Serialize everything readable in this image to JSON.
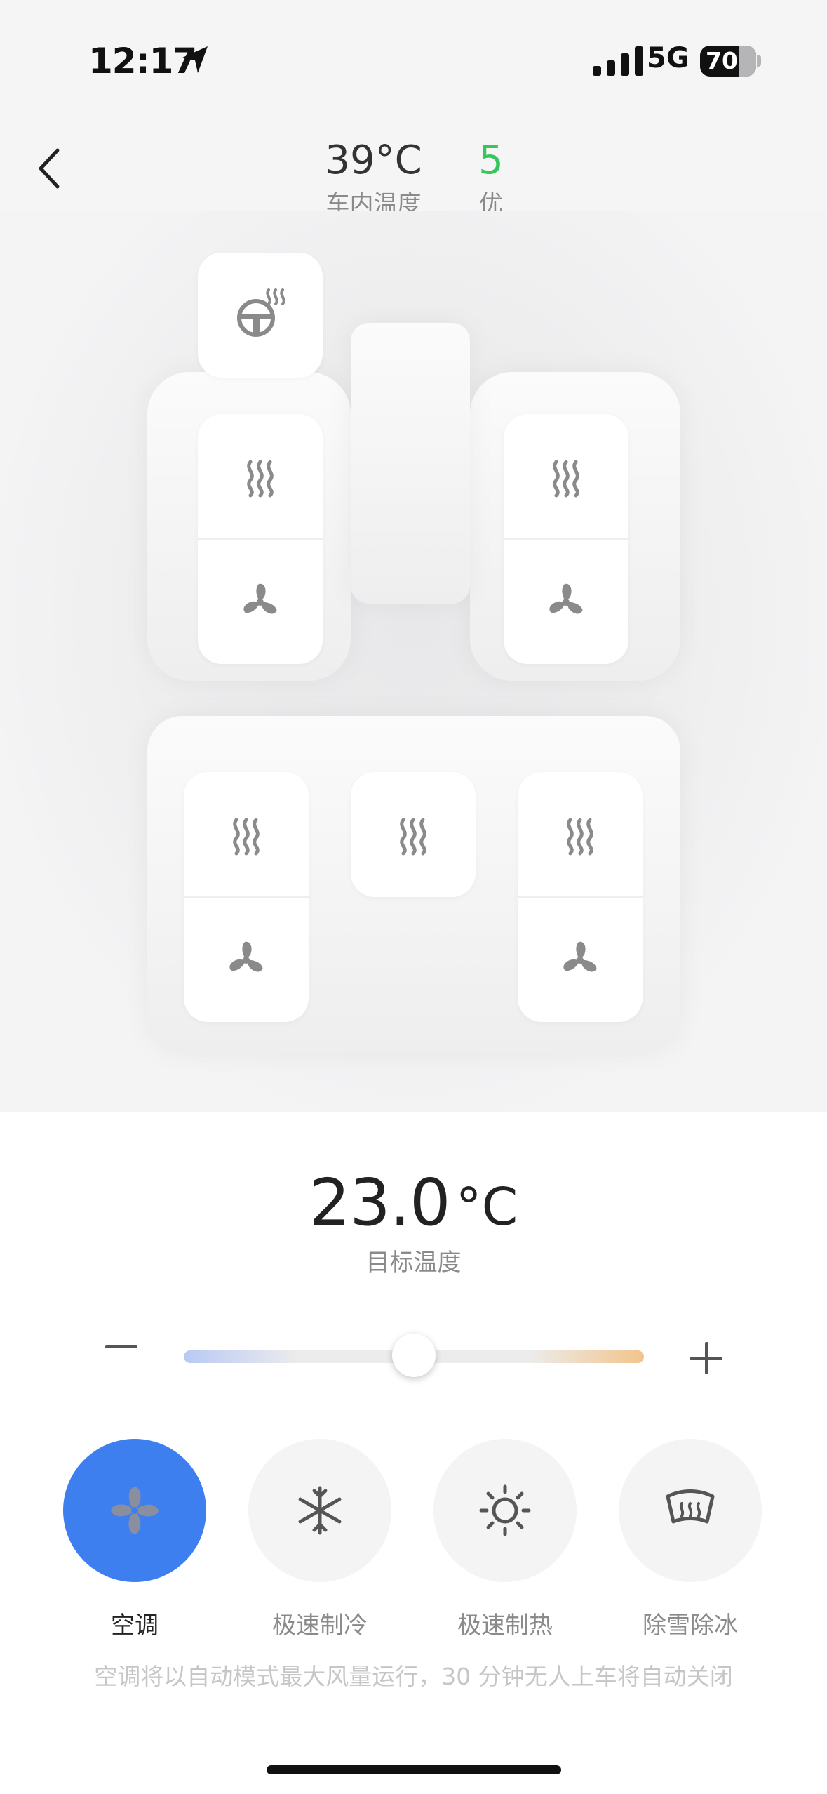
{
  "status_bar": {
    "time": "12:17",
    "network": "5G",
    "battery": "70"
  },
  "header": {
    "cabin_temp_value": "39°C",
    "cabin_temp_label": "车内温度",
    "aqi_value": "5",
    "aqi_label": "优"
  },
  "seats": {
    "steering_wheel": {
      "icon": "steering-wheel-heat-icon"
    },
    "front_left": [
      "seat-heat-icon",
      "seat-fan-icon"
    ],
    "front_right": [
      "seat-heat-icon",
      "seat-fan-icon"
    ],
    "rear_left": [
      "seat-heat-icon",
      "seat-fan-icon"
    ],
    "rear_middle": [
      "seat-heat-icon"
    ],
    "rear_right": [
      "seat-heat-icon",
      "seat-fan-icon"
    ]
  },
  "target": {
    "value": "23.0",
    "unit": "°C",
    "label": "目标温度",
    "slider_fraction": 0.5
  },
  "modes": [
    {
      "label": "空调",
      "icon": "fan-icon",
      "active": true
    },
    {
      "label": "极速制冷",
      "icon": "snowflake-icon",
      "active": false
    },
    {
      "label": "极速制热",
      "icon": "sun-icon",
      "active": false
    },
    {
      "label": "除雪除冰",
      "icon": "defrost-icon",
      "active": false
    }
  ],
  "hint": "空调将以自动模式最大风量运行，30 分钟无人上车将自动关闭",
  "colors": {
    "accent": "#3e7ff0",
    "aqi_good": "#34c759",
    "icon_gray": "#8a8a8a"
  }
}
